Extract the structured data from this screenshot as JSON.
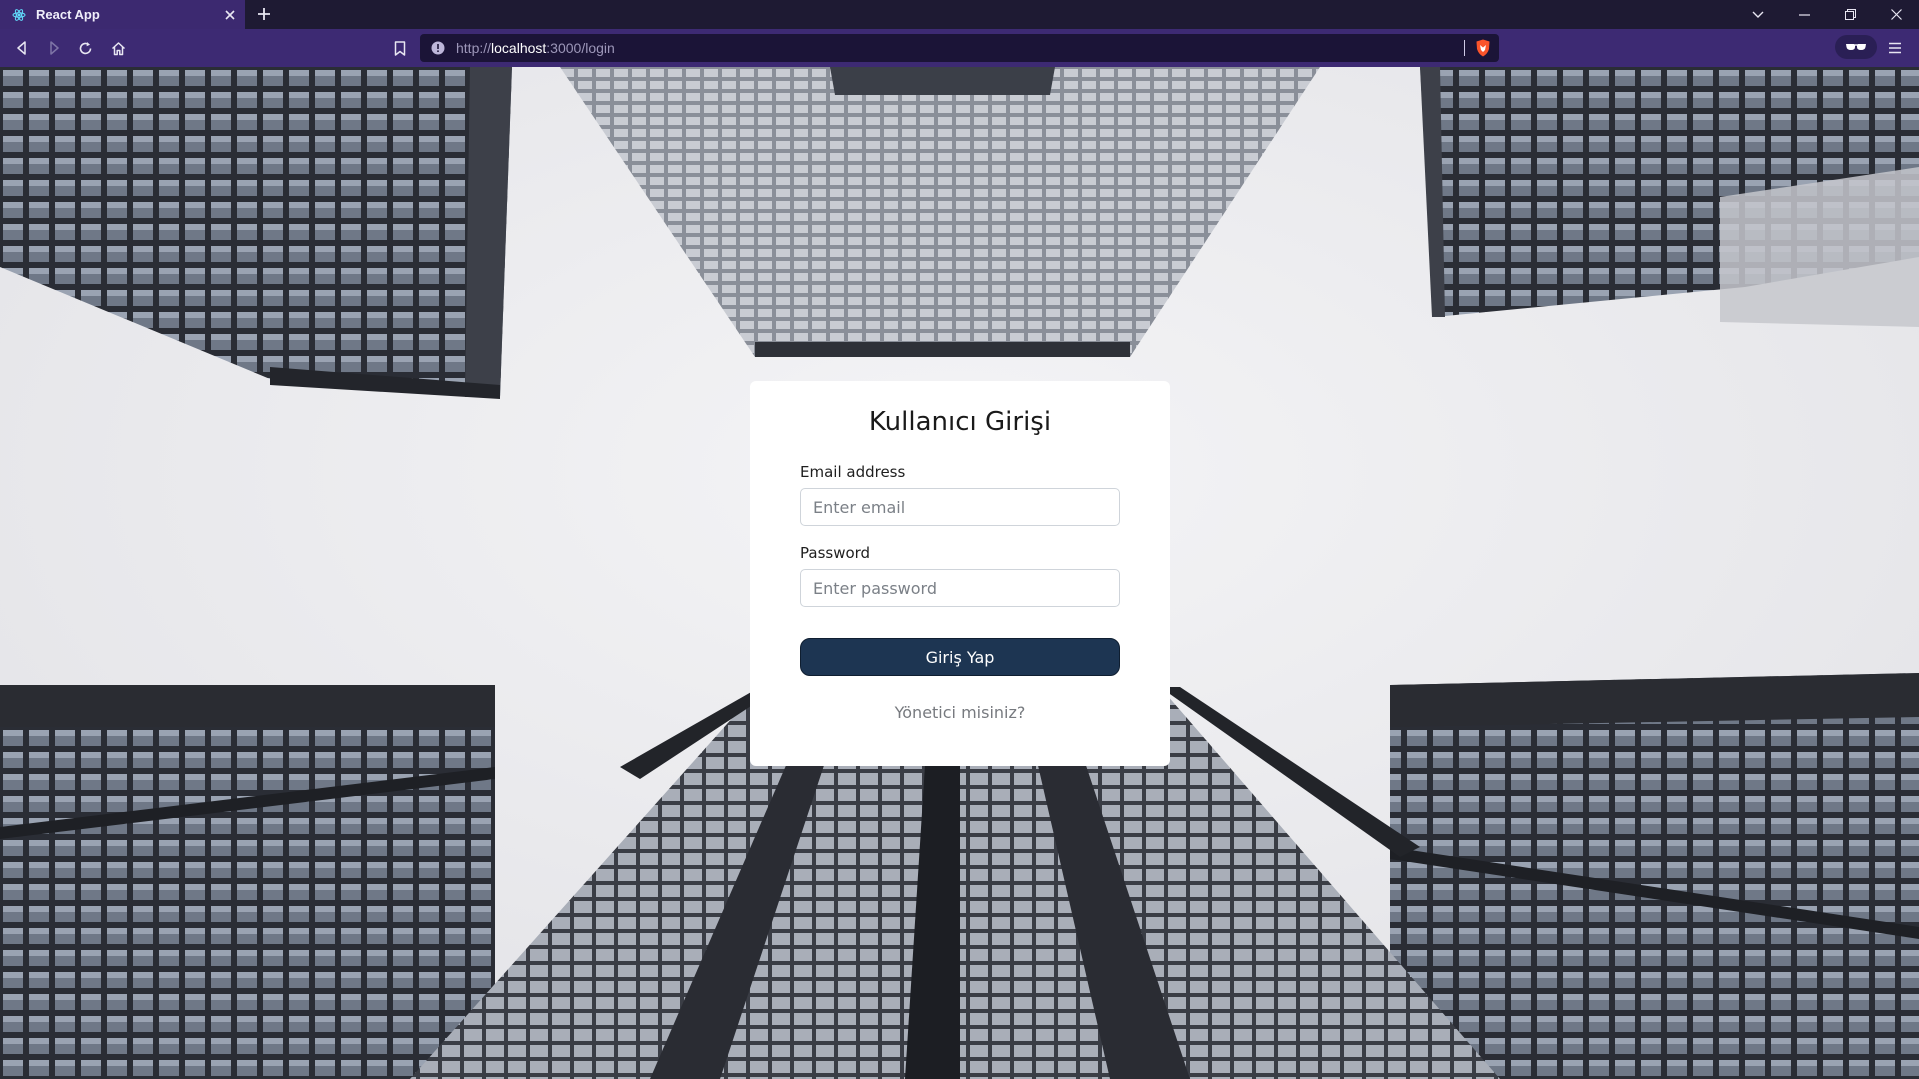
{
  "browser": {
    "tab_title": "React App",
    "url_scheme": "http://",
    "url_host": "localhost",
    "url_rest": ":3000/login",
    "accent_color": "#3d2a73"
  },
  "login": {
    "title": "Kullanıcı Girişi",
    "email_label": "Email address",
    "email_placeholder": "Enter email",
    "email_value": "",
    "password_label": "Password",
    "password_placeholder": "Enter password",
    "password_value": "",
    "submit_label": "Giriş Yap",
    "admin_link": "Yönetici misiniz?",
    "button_color": "#1d3552"
  },
  "icons": {
    "tab_favicon": "react-icon",
    "back": "back-arrow-icon",
    "forward": "forward-arrow-icon",
    "reload": "reload-icon",
    "home": "home-icon",
    "bookmark": "bookmark-icon",
    "site_info": "info-icon",
    "shield": "brave-shield-icon",
    "wallet": "wallet-icon",
    "menu": "hamburger-menu-icon"
  }
}
